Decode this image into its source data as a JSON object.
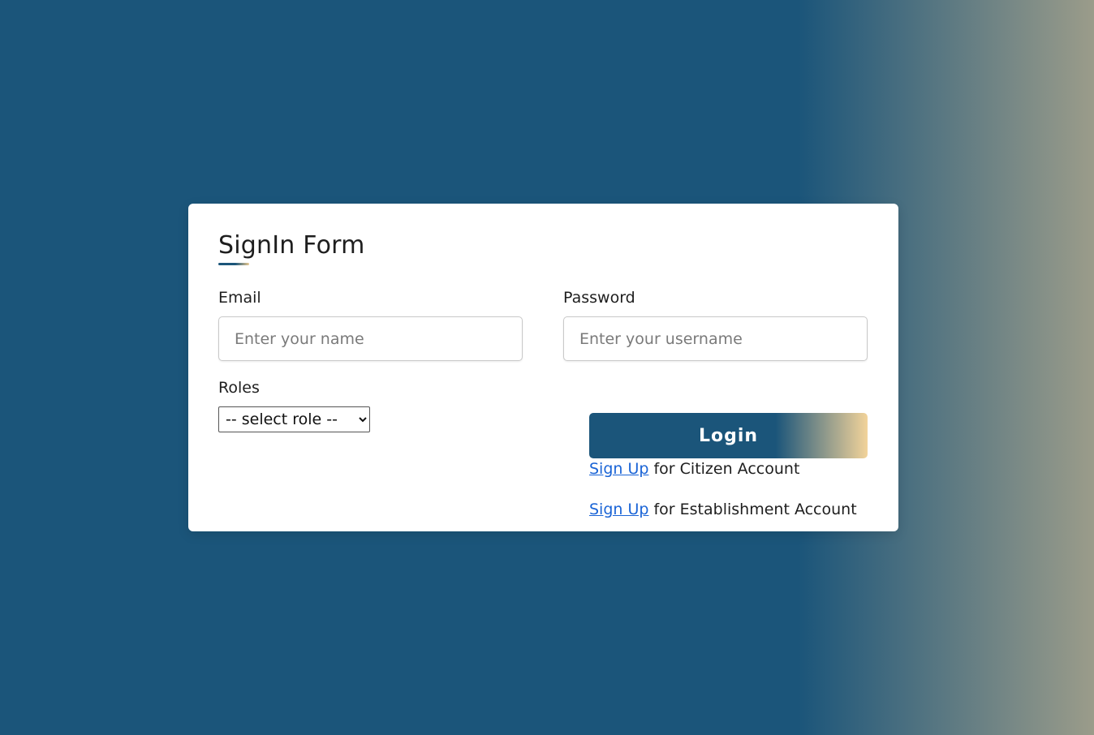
{
  "form": {
    "title": "SignIn Form",
    "email_label": "Email",
    "email_placeholder": "Enter your name",
    "password_label": "Password",
    "password_placeholder": "Enter your username",
    "roles_label": "Roles",
    "role_selected": "-- select role --",
    "login_label": "Login",
    "signup_citizen": {
      "link": "Sign Up",
      "text": " for Citizen Account"
    },
    "signup_establishment": {
      "link": "Sign Up",
      "text": " for Establishment Account"
    }
  },
  "colors": {
    "primary": "#1b557a",
    "accent": "#f2d39a",
    "link": "#1a64d6"
  }
}
